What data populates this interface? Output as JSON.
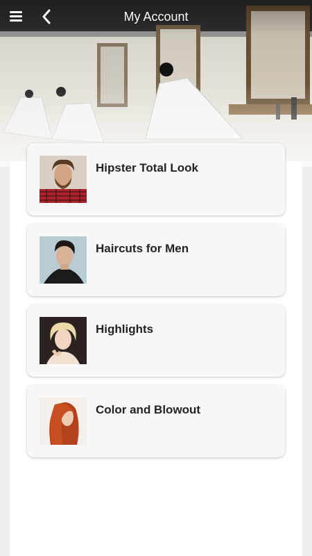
{
  "header": {
    "title": "My Account",
    "menu_icon": "hamburger-menu-icon",
    "back_icon": "chevron-left-icon"
  },
  "services": [
    {
      "label": "Hipster Total Look",
      "image": "bearded-man-photo"
    },
    {
      "label": "Haircuts for Men",
      "image": "dark-haired-man-photo"
    },
    {
      "label": "Highlights",
      "image": "blonde-short-hair-woman-photo"
    },
    {
      "label": "Color and Blowout",
      "image": "red-hair-woman-photo"
    }
  ],
  "colors": {
    "page_background": "#efefef",
    "card_background": "#f8f8f8",
    "text": "#222222",
    "header_text": "#ffffff"
  }
}
